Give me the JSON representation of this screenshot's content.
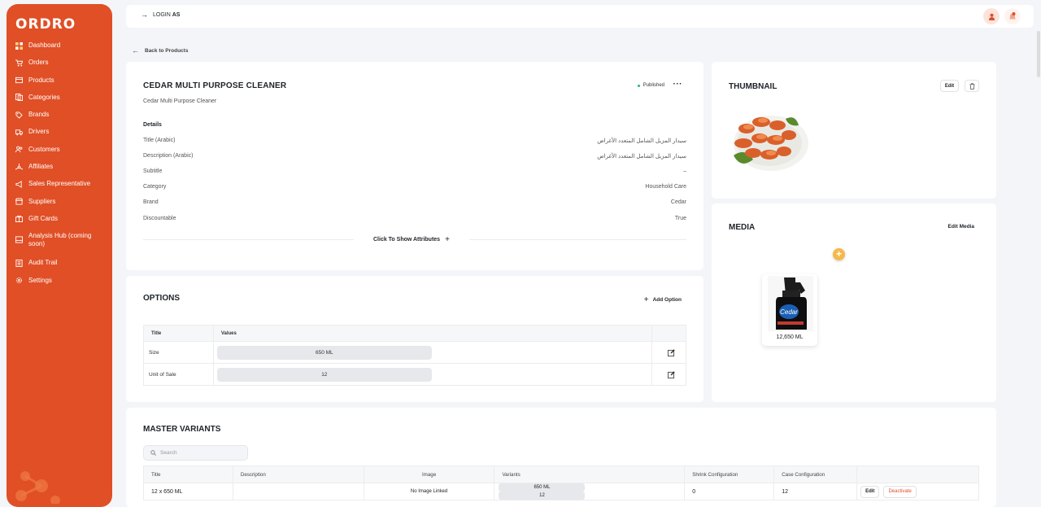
{
  "brand": {
    "logo": "ORDRO",
    "accent": "#e04f26"
  },
  "sidebar": {
    "items": [
      {
        "label": "Dashboard",
        "icon": "dashboard-icon"
      },
      {
        "label": "Orders",
        "icon": "cart-icon"
      },
      {
        "label": "Products",
        "icon": "products-icon"
      },
      {
        "label": "Categories",
        "icon": "categories-icon"
      },
      {
        "label": "Brands",
        "icon": "tag-icon"
      },
      {
        "label": "Drivers",
        "icon": "truck-icon"
      },
      {
        "label": "Customers",
        "icon": "users-icon"
      },
      {
        "label": "Affiliates",
        "icon": "affiliates-icon"
      },
      {
        "label": "Sales Representative",
        "icon": "megaphone-icon"
      },
      {
        "label": "Suppliers",
        "icon": "store-icon"
      },
      {
        "label": "Gift Cards",
        "icon": "gift-icon"
      },
      {
        "label": "Analysis Hub (coming soon)",
        "icon": "analysis-icon"
      },
      {
        "label": "Audit Trail",
        "icon": "audit-icon"
      },
      {
        "label": "Settings",
        "icon": "gear-icon"
      }
    ]
  },
  "topbar": {
    "login_as": "LOGIN",
    "login_as_bold": "AS"
  },
  "back_link": "Back to Products",
  "product": {
    "title": "CEDAR MULTI PURPOSE CLEANER",
    "subtitle": "Cedar Multi Purpose Cleaner",
    "status": "Published",
    "more": "···",
    "details_heading": "Details",
    "details": [
      {
        "label": "Title (Arabic)",
        "value": "سيدار المزيل الشامل المتعدد الأغراض"
      },
      {
        "label": "Description (Arabic)",
        "value": "سيدار المزيل الشامل المتعدد الأغراض"
      },
      {
        "label": "Subtitle",
        "value": "–"
      },
      {
        "label": "Category",
        "value": "Household Care"
      },
      {
        "label": "Brand",
        "value": "Cedar"
      },
      {
        "label": "Discountable",
        "value": "True"
      }
    ],
    "show_attributes": "Click To Show Attributes"
  },
  "options": {
    "title": "OPTIONS",
    "add_label": "Add Option",
    "headers": [
      "Title",
      "Values"
    ],
    "rows": [
      {
        "title": "Size",
        "value": "650 ML"
      },
      {
        "title": "Unit of Sale",
        "value": "12"
      }
    ]
  },
  "thumbnail": {
    "title": "THUMBNAIL",
    "edit_label": "Edit"
  },
  "media": {
    "title": "MEDIA",
    "edit_label": "Edit Media",
    "item_label": "12,650 ML",
    "add": "+"
  },
  "variants": {
    "title": "MASTER VARIANTS",
    "search_placeholder": "Search",
    "headers": [
      "Title",
      "Description",
      "Image",
      "Variants",
      "Shrink Configuration",
      "Case Configuration"
    ],
    "rows": [
      {
        "title": "12 x 650 ML",
        "description": "",
        "image": "No Image Linked",
        "variant_a": "650 ML",
        "variant_b": "12",
        "shrink": "0",
        "case": "12",
        "edit": "Edit",
        "deactivate": "Deactivate"
      }
    ]
  }
}
